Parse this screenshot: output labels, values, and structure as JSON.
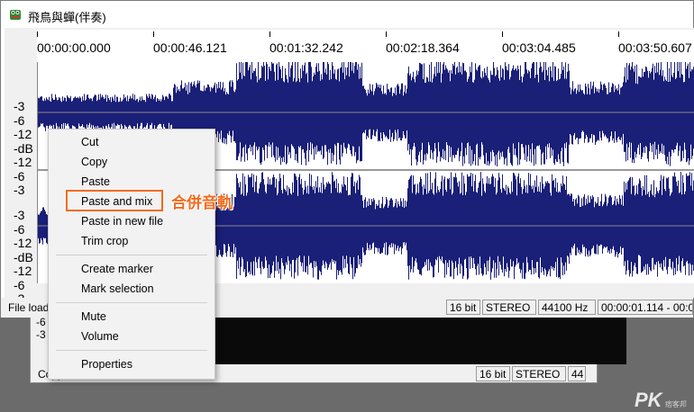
{
  "window": {
    "title": "飛鳥與蟬(伴奏)",
    "icon": "frog-app-icon"
  },
  "timeline": {
    "ticks": [
      "00:00:00.000",
      "00:00:46.121",
      "00:01:32.242",
      "00:02:18.364",
      "00:03:04.485",
      "00:03:50.607"
    ]
  },
  "db_scale": {
    "top": [
      "-3",
      "-6",
      "-12",
      "-dB",
      "-12",
      "-6",
      "-3"
    ],
    "bottom": [
      "-3",
      "-6",
      "-12",
      "-dB",
      "-12",
      "-6",
      "-3"
    ]
  },
  "status": {
    "label": "File loaded",
    "bit_depth": "16 bit",
    "channels": "STEREO",
    "sample_rate": "44100 Hz",
    "position": "00:00:01.114 - 00:0"
  },
  "background_window": {
    "db_labels": [
      "-6",
      "-3"
    ],
    "status_label": "Copy",
    "bit_depth": "16 bit",
    "channels": "STEREO",
    "sample_rate": "44"
  },
  "context_menu": {
    "items": [
      "Cut",
      "Copy",
      "Paste",
      "Paste and mix",
      "Paste in new file",
      "Trim crop",
      "Create marker",
      "Mark selection",
      "Mute",
      "Volume",
      "Properties"
    ],
    "highlighted": "Paste and mix"
  },
  "annotation": {
    "text": "合併音軌",
    "color": "#f26b1d"
  },
  "watermark": {
    "text": "PK",
    "sub": "痞客邦"
  },
  "colors": {
    "waveform": "#1a1f78",
    "annotation": "#f26b1d"
  }
}
